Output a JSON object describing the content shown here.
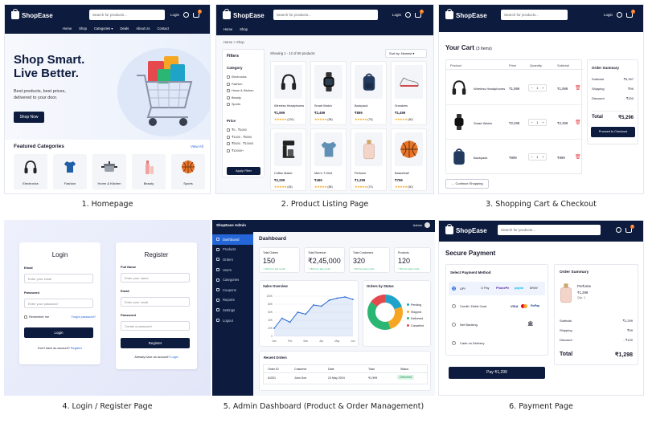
{
  "brand": "ShopEase",
  "search_placeholder": "Search for products...",
  "login_label": "Login",
  "cart_count": "3",
  "captions": [
    "1. Homepage",
    "2. Product Listing Page",
    "3. Shopping Cart & Checkout",
    "4. Login / Register Page",
    "5. Admin Dashboard (Product & Order Management)",
    "6. Payment Page"
  ],
  "home": {
    "nav": [
      "Home",
      "Shop",
      "Categories",
      "Deals",
      "About Us",
      "Contact"
    ],
    "hero_line1": "Shop Smart.",
    "hero_line2": "Live Better.",
    "hero_sub1": "Best products, best prices,",
    "hero_sub2": "delivered to your door.",
    "hero_button": "Shop Now",
    "featured_title": "Featured Categories",
    "view_all": "View All",
    "categories": [
      "Electronics",
      "Fashion",
      "Home & Kitchen",
      "Beauty",
      "Sports"
    ]
  },
  "listing": {
    "nav": [
      "Home",
      "Shop"
    ],
    "breadcrumb_home": "Home",
    "breadcrumb_sep": ">",
    "breadcrumb_current": "Shop",
    "filters_title": "Filters",
    "category_title": "Category",
    "categories": [
      "Electronics",
      "Fashion",
      "Home & Kitchen",
      "Beauty",
      "Sports"
    ],
    "price_title": "Price",
    "prices": [
      "₹0 - ₹1000",
      "₹1000 - ₹5000",
      "₹5000 - ₹10000",
      "₹10000+"
    ],
    "apply_filter": "Apply Filter",
    "showing": "Showing 1 - 12 of 60 products",
    "sort": "Sort by: Newest",
    "products": [
      {
        "name": "Wireless Headphones",
        "price": "₹1,999",
        "reviews": "(120)"
      },
      {
        "name": "Smart Watch",
        "price": "₹2,499",
        "reviews": "(98)"
      },
      {
        "name": "Backpack",
        "price": "₹899",
        "reviews": "(75)"
      },
      {
        "name": "Sneakers",
        "price": "₹1,499",
        "reviews": "(60)"
      },
      {
        "name": "Coffee Maker",
        "price": "₹2,299",
        "reviews": "(45)"
      },
      {
        "name": "Men's T-Shirt",
        "price": "₹499",
        "reviews": "(85)"
      },
      {
        "name": "Perfume",
        "price": "₹1,299",
        "reviews": "(70)"
      },
      {
        "name": "Basketball",
        "price": "₹799",
        "reviews": "(60)"
      }
    ]
  },
  "cart": {
    "title": "Your Cart",
    "items_count": "(3 Items)",
    "headers": [
      "Product",
      "Price",
      "Quantity",
      "Subtotal"
    ],
    "items": [
      {
        "name": "Wireless Headphones",
        "price": "₹1,999",
        "qty": "1",
        "subtotal": "₹1,999"
      },
      {
        "name": "Smart Watch",
        "price": "₹2,499",
        "qty": "1",
        "subtotal": "₹2,499"
      },
      {
        "name": "Backpack",
        "price": "₹899",
        "qty": "1",
        "subtotal": "₹899"
      }
    ],
    "continue": "Continue Shopping",
    "summary_title": "Order Summary",
    "subtotal_label": "Subtotal",
    "subtotal": "₹5,397",
    "shipping_label": "Shipping",
    "shipping": "₹99",
    "discount_label": "Discount",
    "discount": "- ₹200",
    "total_label": "Total",
    "total": "₹5,296",
    "checkout": "Proceed to Checkout"
  },
  "auth": {
    "login_title": "Login",
    "email_label": "Email",
    "email_placeholder": "Enter your email",
    "password_label": "Password",
    "password_placeholder": "Enter your password",
    "remember": "Remember me",
    "forgot": "Forgot password?",
    "login_button": "Login",
    "no_account": "Don't have an account?",
    "register_link": "Register",
    "register_title": "Register",
    "fullname_label": "Full Name",
    "fullname_placeholder": "Enter your name",
    "create_password_placeholder": "Create a password",
    "register_button": "Register",
    "have_account": "Already have an account?",
    "login_link": "Login"
  },
  "admin": {
    "title": "ShopEase Admin",
    "user": "Admin",
    "sidebar": [
      "Dashboard",
      "Products",
      "Orders",
      "Users",
      "Categories",
      "Coupons",
      "Reports",
      "Settings",
      "Logout"
    ],
    "heading": "Dashboard",
    "kpis": [
      {
        "label": "Total Orders",
        "value": "150",
        "delta": "↑ 12% from last month"
      },
      {
        "label": "Total Revenue",
        "value": "₹2,45,000",
        "delta": "↑ 18% from last month"
      },
      {
        "label": "Total Customers",
        "value": "320",
        "delta": "↑ 8% from last month"
      },
      {
        "label": "Products",
        "value": "120",
        "delta": "↑ 5% from last month"
      }
    ],
    "sales_title": "Sales Overview",
    "status_title": "Orders by Status",
    "recent_title": "Recent Orders",
    "order_headers": [
      "Order ID",
      "Customer",
      "Date",
      "Total",
      "Status"
    ],
    "order_row": [
      "#1001",
      "John Doe",
      "24 May 2024",
      "₹1,999",
      "Delivered"
    ]
  },
  "chart_data": [
    {
      "type": "line",
      "title": "Sales Overview",
      "x": [
        "Jan",
        "Feb",
        "Mar",
        "Apr",
        "May",
        "Jun"
      ],
      "series": [
        {
          "values": [
            20,
            45,
            35,
            60,
            55,
            78,
            75,
            90,
            95,
            98,
            92
          ]
        }
      ],
      "ylim": [
        0,
        100
      ],
      "yticks": [
        "0",
        "20K",
        "40K",
        "60K",
        "80K",
        "100K"
      ],
      "grid": true
    },
    {
      "type": "pie",
      "title": "Orders by Status",
      "labels": [
        "Pending",
        "Shipped",
        "Delivered",
        "Cancelled"
      ],
      "values": [
        20,
        25,
        40,
        15
      ],
      "colors": [
        "#1fa3c9",
        "#f5a623",
        "#2bb673",
        "#e5484d"
      ]
    }
  ],
  "payment": {
    "title": "Secure Payment",
    "method_title": "Select Payment Method",
    "methods": [
      "UPI",
      "Credit / Debit Card",
      "Net Banking",
      "Cash on Delivery"
    ],
    "upi_brands": [
      "G Pay",
      "PhonePe",
      "paytm",
      "BHIM"
    ],
    "card_brands": [
      "VISA",
      "RuPay"
    ],
    "summary_title": "Order Summary",
    "item_name": "Perfume",
    "item_price": "₹1,299",
    "item_qty": "Qty: 1",
    "subtotal_label": "Subtotal",
    "subtotal": "₹1,299",
    "shipping_label": "Shipping",
    "shipping": "₹99",
    "discount_label": "Discount",
    "discount": "- ₹100",
    "total_label": "Total",
    "total": "₹1,298",
    "pay_button": "Pay ₹1,299"
  }
}
